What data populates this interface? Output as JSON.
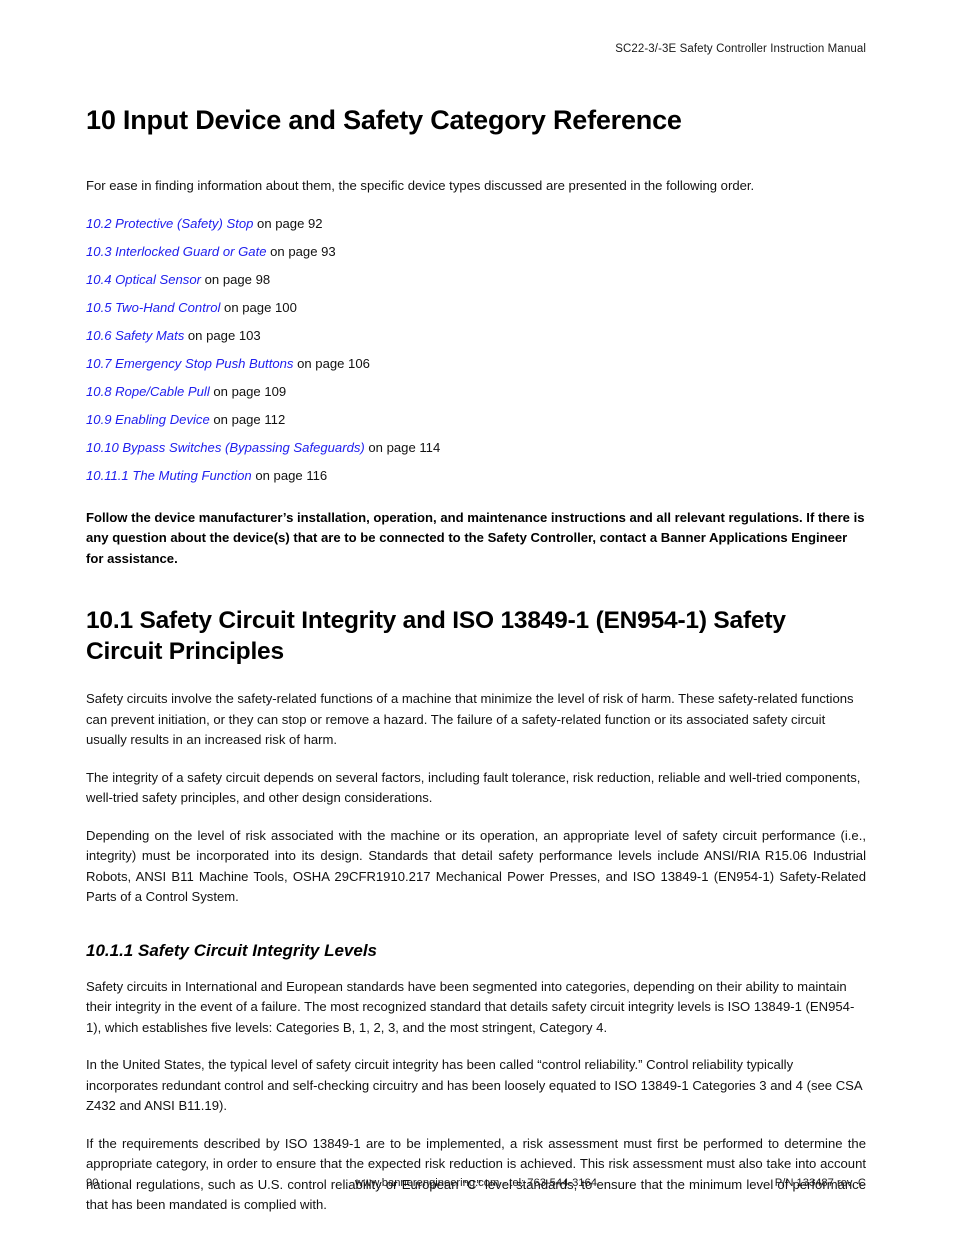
{
  "header": {
    "running_title": "SC22-3/-3E Safety Controller Instruction Manual"
  },
  "chapter": {
    "title": "10 Input Device and Safety Category Reference",
    "intro": "For ease in finding information about them, the specific device types discussed are presented in the following order."
  },
  "cross_references": [
    {
      "link": "10.2 Protective (Safety) Stop",
      "tail": " on page 92"
    },
    {
      "link": "10.3 Interlocked Guard or Gate",
      "tail": " on page 93"
    },
    {
      "link": "10.4 Optical Sensor",
      "tail": " on page 98"
    },
    {
      "link": "10.5 Two-Hand Control",
      "tail": " on page 100"
    },
    {
      "link": "10.6 Safety Mats",
      "tail": " on page 103"
    },
    {
      "link": "10.7 Emergency Stop Push Buttons",
      "tail": " on page 106"
    },
    {
      "link": "10.8 Rope/Cable Pull",
      "tail": " on page 109"
    },
    {
      "link": "10.9 Enabling Device",
      "tail": " on page 112"
    },
    {
      "link": "10.10 Bypass Switches (Bypassing Safeguards)",
      "tail": " on page 114"
    },
    {
      "link": "10.11.1 The Muting Function",
      "tail": " on page 116"
    }
  ],
  "notice": "Follow the device manufacturer’s installation, operation, and maintenance instructions and all relevant regulations. If there is any question about the device(s) that are to be connected to the Safety Controller, contact a Banner Applications Engineer for assistance.",
  "section_10_1": {
    "title": "10.1 Safety Circuit Integrity and ISO 13849-1 (EN954-1) Safety Circuit Principles",
    "paragraphs": [
      "Safety circuits involve the safety-related functions of a machine that minimize the level of risk of harm. These safety-related functions can prevent initiation, or they can stop or remove a hazard. The failure of a safety-related function or its associated safety circuit usually results in an increased risk of harm.",
      "The integrity of a safety circuit depends on several factors, including fault tolerance, risk reduction, reliable and well-tried components, well-tried safety principles, and other design considerations.",
      "Depending on the level of risk associated with the machine or its operation, an appropriate level of safety circuit performance (i.e., integrity) must be incorporated into its design. Standards that detail safety performance levels include ANSI/RIA R15.06 Industrial Robots, ANSI B11 Machine Tools, OSHA 29CFR1910.217 Mechanical Power Presses, and ISO 13849-1 (EN954-1) Safety-Related Parts of a Control System."
    ]
  },
  "section_10_1_1": {
    "title": "10.1.1 Safety Circuit Integrity Levels",
    "paragraphs": [
      "Safety circuits in International and European standards have been segmented into categories, depending on their ability to maintain their integrity in the event of a failure. The most recognized standard that details safety circuit integrity levels is ISO 13849-1 (EN954-1), which establishes five levels: Categories B, 1, 2, 3, and the most stringent, Category 4.",
      "In the United States, the typical level of safety circuit integrity has been called “control reliability.” Control reliability typically incorporates redundant control and self-checking circuitry and has been loosely equated to ISO 13849-1 Categories 3 and 4 (see CSA Z432 and ANSI B11.19).",
      "If the requirements described by ISO 13849-1 are to be implemented, a risk assessment must first be performed to determine the appropriate category, in order to ensure that the expected risk reduction is achieved. This risk assessment must also take into account national regulations, such as U.S. control reliability or European “C” level standards, to ensure that the minimum level of performance that has been mandated is complied with."
    ]
  },
  "footer": {
    "page_number": "90",
    "center": "www.bannerengineering.com - tel: 763-544-3164",
    "part_number": "P/N 133487 rev. C"
  },
  "colors": {
    "link": "#2020ee",
    "text": "#111111",
    "page_background": "#ffffff"
  }
}
